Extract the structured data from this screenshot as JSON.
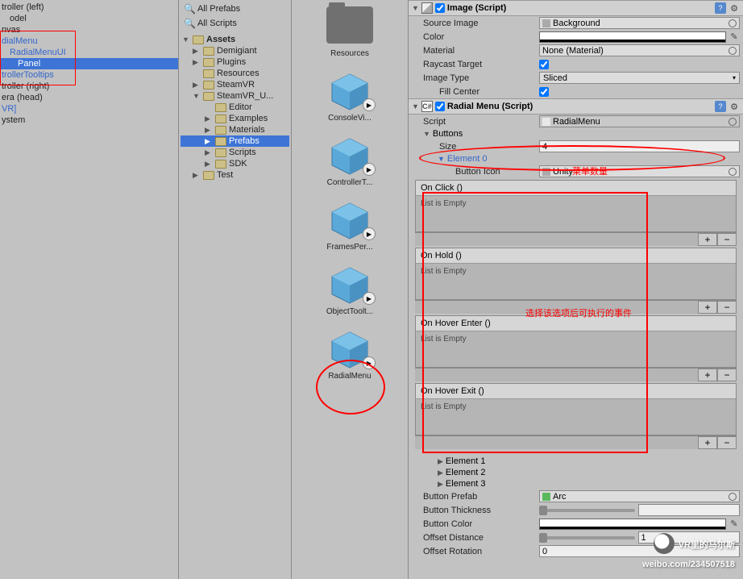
{
  "hierarchy": {
    "items": [
      {
        "label": "troller (left)",
        "blue": false,
        "indent": 0
      },
      {
        "label": "odel",
        "blue": false,
        "indent": 1
      },
      {
        "label": "nvas",
        "blue": false,
        "indent": 0
      },
      {
        "label": "dialMenu",
        "blue": true,
        "indent": 0
      },
      {
        "label": "RadialMenuUI",
        "blue": true,
        "indent": 1
      },
      {
        "label": "Panel",
        "blue": false,
        "indent": 2,
        "selected": true
      },
      {
        "label": "trollerTooltips",
        "blue": true,
        "indent": 0
      },
      {
        "label": "troller (right)",
        "blue": false,
        "indent": 0
      },
      {
        "label": "era (head)",
        "blue": false,
        "indent": 0
      },
      {
        "label": "VR]",
        "blue": true,
        "indent": 0
      },
      {
        "label": "ystem",
        "blue": false,
        "indent": 0
      }
    ]
  },
  "project": {
    "search": {
      "all_prefabs": "All Prefabs",
      "all_scripts": "All Scripts"
    },
    "assets_label": "Assets",
    "folders": [
      {
        "label": "Demigiant",
        "indent": 1,
        "arrow": "▶"
      },
      {
        "label": "Plugins",
        "indent": 1,
        "arrow": "▶"
      },
      {
        "label": "Resources",
        "indent": 1,
        "arrow": ""
      },
      {
        "label": "SteamVR",
        "indent": 1,
        "arrow": "▶"
      },
      {
        "label": "SteamVR_U...",
        "indent": 1,
        "arrow": "▼"
      },
      {
        "label": "Editor",
        "indent": 2,
        "arrow": ""
      },
      {
        "label": "Examples",
        "indent": 2,
        "arrow": "▶"
      },
      {
        "label": "Materials",
        "indent": 2,
        "arrow": "▶"
      },
      {
        "label": "Prefabs",
        "indent": 2,
        "arrow": "▶",
        "selected": true
      },
      {
        "label": "Scripts",
        "indent": 2,
        "arrow": "▶"
      },
      {
        "label": "SDK",
        "indent": 2,
        "arrow": "▶"
      },
      {
        "label": "Test",
        "indent": 1,
        "arrow": "▶"
      }
    ]
  },
  "asset_grid": [
    {
      "label": "Resources",
      "type": "folder"
    },
    {
      "label": "ConsoleVi...",
      "type": "prefab"
    },
    {
      "label": "ControllerT...",
      "type": "prefab"
    },
    {
      "label": "FramesPer...",
      "type": "prefab"
    },
    {
      "label": "ObjectToolt...",
      "type": "prefab"
    },
    {
      "label": "RadialMenu",
      "type": "prefab"
    }
  ],
  "inspector": {
    "image": {
      "title": "Image (Script)",
      "source_image": {
        "label": "Source Image",
        "value": "Background"
      },
      "color": {
        "label": "Color"
      },
      "material": {
        "label": "Material",
        "value": "None (Material)"
      },
      "raycast_target": {
        "label": "Raycast Target",
        "checked": true
      },
      "image_type": {
        "label": "Image Type",
        "value": "Sliced"
      },
      "fill_center": {
        "label": "Fill Center",
        "checked": true
      }
    },
    "radial_menu": {
      "title": "Radial Menu (Script)",
      "script": {
        "label": "Script",
        "value": "RadialMenu"
      },
      "buttons": {
        "label": "Buttons"
      },
      "size": {
        "label": "Size",
        "value": "4"
      },
      "element0": {
        "label": "Element 0"
      },
      "button_icon": {
        "label": "Button Icon",
        "value": "Unity"
      },
      "events": [
        {
          "title": "On Click ()",
          "body": "List is Empty"
        },
        {
          "title": "On Hold ()",
          "body": "List is Empty"
        },
        {
          "title": "On Hover Enter ()",
          "body": "List is Empty"
        },
        {
          "title": "On Hover Exit ()",
          "body": "List is Empty"
        }
      ],
      "elements": [
        {
          "label": "Element 1"
        },
        {
          "label": "Element 2"
        },
        {
          "label": "Element 3"
        }
      ],
      "button_prefab": {
        "label": "Button Prefab",
        "value": "Arc"
      },
      "button_thickness": {
        "label": "Button Thickness"
      },
      "button_color": {
        "label": "Button Color"
      },
      "offset_distance": {
        "label": "Offset Distance",
        "value": "1"
      },
      "offset_rotation": {
        "label": "Offset Rotation",
        "value": "0"
      }
    }
  },
  "annotations": {
    "menu_count": "菜单数量",
    "event_note": "选择该选项后可执行的事件"
  },
  "watermark": {
    "line1": "VR里的马尔斯",
    "line2": "weibo.com/234507518"
  }
}
